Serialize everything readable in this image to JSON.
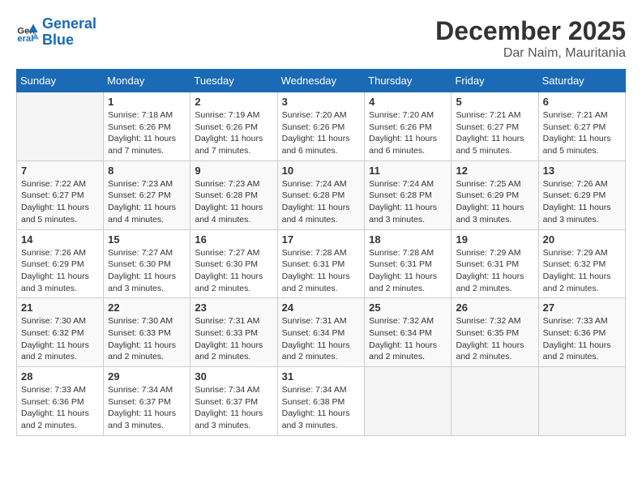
{
  "logo": {
    "line1": "General",
    "line2": "Blue"
  },
  "title": "December 2025",
  "location": "Dar Naim, Mauritania",
  "days_of_week": [
    "Sunday",
    "Monday",
    "Tuesday",
    "Wednesday",
    "Thursday",
    "Friday",
    "Saturday"
  ],
  "weeks": [
    [
      {
        "day": "",
        "info": ""
      },
      {
        "day": "1",
        "info": "Sunrise: 7:18 AM\nSunset: 6:26 PM\nDaylight: 11 hours\nand 7 minutes."
      },
      {
        "day": "2",
        "info": "Sunrise: 7:19 AM\nSunset: 6:26 PM\nDaylight: 11 hours\nand 7 minutes."
      },
      {
        "day": "3",
        "info": "Sunrise: 7:20 AM\nSunset: 6:26 PM\nDaylight: 11 hours\nand 6 minutes."
      },
      {
        "day": "4",
        "info": "Sunrise: 7:20 AM\nSunset: 6:26 PM\nDaylight: 11 hours\nand 6 minutes."
      },
      {
        "day": "5",
        "info": "Sunrise: 7:21 AM\nSunset: 6:27 PM\nDaylight: 11 hours\nand 5 minutes."
      },
      {
        "day": "6",
        "info": "Sunrise: 7:21 AM\nSunset: 6:27 PM\nDaylight: 11 hours\nand 5 minutes."
      }
    ],
    [
      {
        "day": "7",
        "info": "Sunrise: 7:22 AM\nSunset: 6:27 PM\nDaylight: 11 hours\nand 5 minutes."
      },
      {
        "day": "8",
        "info": "Sunrise: 7:23 AM\nSunset: 6:27 PM\nDaylight: 11 hours\nand 4 minutes."
      },
      {
        "day": "9",
        "info": "Sunrise: 7:23 AM\nSunset: 6:28 PM\nDaylight: 11 hours\nand 4 minutes."
      },
      {
        "day": "10",
        "info": "Sunrise: 7:24 AM\nSunset: 6:28 PM\nDaylight: 11 hours\nand 4 minutes."
      },
      {
        "day": "11",
        "info": "Sunrise: 7:24 AM\nSunset: 6:28 PM\nDaylight: 11 hours\nand 3 minutes."
      },
      {
        "day": "12",
        "info": "Sunrise: 7:25 AM\nSunset: 6:29 PM\nDaylight: 11 hours\nand 3 minutes."
      },
      {
        "day": "13",
        "info": "Sunrise: 7:26 AM\nSunset: 6:29 PM\nDaylight: 11 hours\nand 3 minutes."
      }
    ],
    [
      {
        "day": "14",
        "info": "Sunrise: 7:26 AM\nSunset: 6:29 PM\nDaylight: 11 hours\nand 3 minutes."
      },
      {
        "day": "15",
        "info": "Sunrise: 7:27 AM\nSunset: 6:30 PM\nDaylight: 11 hours\nand 3 minutes."
      },
      {
        "day": "16",
        "info": "Sunrise: 7:27 AM\nSunset: 6:30 PM\nDaylight: 11 hours\nand 2 minutes."
      },
      {
        "day": "17",
        "info": "Sunrise: 7:28 AM\nSunset: 6:31 PM\nDaylight: 11 hours\nand 2 minutes."
      },
      {
        "day": "18",
        "info": "Sunrise: 7:28 AM\nSunset: 6:31 PM\nDaylight: 11 hours\nand 2 minutes."
      },
      {
        "day": "19",
        "info": "Sunrise: 7:29 AM\nSunset: 6:31 PM\nDaylight: 11 hours\nand 2 minutes."
      },
      {
        "day": "20",
        "info": "Sunrise: 7:29 AM\nSunset: 6:32 PM\nDaylight: 11 hours\nand 2 minutes."
      }
    ],
    [
      {
        "day": "21",
        "info": "Sunrise: 7:30 AM\nSunset: 6:32 PM\nDaylight: 11 hours\nand 2 minutes."
      },
      {
        "day": "22",
        "info": "Sunrise: 7:30 AM\nSunset: 6:33 PM\nDaylight: 11 hours\nand 2 minutes."
      },
      {
        "day": "23",
        "info": "Sunrise: 7:31 AM\nSunset: 6:33 PM\nDaylight: 11 hours\nand 2 minutes."
      },
      {
        "day": "24",
        "info": "Sunrise: 7:31 AM\nSunset: 6:34 PM\nDaylight: 11 hours\nand 2 minutes."
      },
      {
        "day": "25",
        "info": "Sunrise: 7:32 AM\nSunset: 6:34 PM\nDaylight: 11 hours\nand 2 minutes."
      },
      {
        "day": "26",
        "info": "Sunrise: 7:32 AM\nSunset: 6:35 PM\nDaylight: 11 hours\nand 2 minutes."
      },
      {
        "day": "27",
        "info": "Sunrise: 7:33 AM\nSunset: 6:36 PM\nDaylight: 11 hours\nand 2 minutes."
      }
    ],
    [
      {
        "day": "28",
        "info": "Sunrise: 7:33 AM\nSunset: 6:36 PM\nDaylight: 11 hours\nand 2 minutes."
      },
      {
        "day": "29",
        "info": "Sunrise: 7:34 AM\nSunset: 6:37 PM\nDaylight: 11 hours\nand 3 minutes."
      },
      {
        "day": "30",
        "info": "Sunrise: 7:34 AM\nSunset: 6:37 PM\nDaylight: 11 hours\nand 3 minutes."
      },
      {
        "day": "31",
        "info": "Sunrise: 7:34 AM\nSunset: 6:38 PM\nDaylight: 11 hours\nand 3 minutes."
      },
      {
        "day": "",
        "info": ""
      },
      {
        "day": "",
        "info": ""
      },
      {
        "day": "",
        "info": ""
      }
    ]
  ]
}
